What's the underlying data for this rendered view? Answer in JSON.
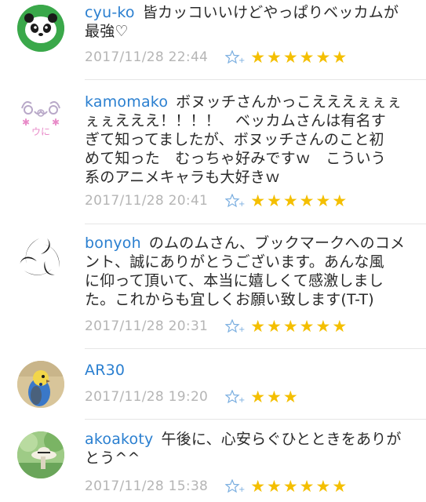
{
  "comments": [
    {
      "username": "cyu-ko",
      "text": "皆カッコいいけどやっぱりベッカム が最強♡",
      "lines": [
        "皆カッコいいけどやっぱりベッカムが",
        "最強♡"
      ],
      "timestamp": "2017/11/28 22:44",
      "avatar": "panda-avatar",
      "star_count": 6
    },
    {
      "username": "kamomako",
      "lines": [
        "ボヌッチさんかっこえええぇぇぇ",
        "ぇぇえええ！！！！　ベッカムさんは有名す",
        "ぎて知ってましたが、ボヌッチさんのこと初",
        "めて知った　むっちゃ好みですｗ　こういう",
        "系のアニメキャラも大好きｗ"
      ],
      "timestamp": "2017/11/28 20:41",
      "avatar": "cute-face-avatar",
      "star_count": 6
    },
    {
      "username": "bonyoh",
      "lines": [
        "のムのムさん、ブックマークへのコメ",
        "ント、誠にありがとうございます。あんな風",
        "に仰って頂いて、本当に嬉しくて感激しまし",
        "た。これからも宜しくお願い致します(T-T)"
      ],
      "timestamp": "2017/11/28 20:31",
      "avatar": "tomoe-avatar",
      "star_count": 6
    },
    {
      "username": "AR30",
      "lines": [],
      "timestamp": "2017/11/28 19:20",
      "avatar": "parakeet-avatar",
      "star_count": 3
    },
    {
      "username": "akoakoty",
      "lines": [
        "午後に、心安らぐひとときをありが",
        "とう^^"
      ],
      "timestamp": "2017/11/28 15:38",
      "avatar": "hat-photo-avatar",
      "star_count": 6
    }
  ],
  "star_glyphs": {
    "six": "★★★★★★",
    "three": "★★★"
  },
  "colors": {
    "username": "#2a7fd0",
    "star": "#f4bf00",
    "timestamp": "#b5b5b5",
    "add_star": "#7aaee0"
  }
}
